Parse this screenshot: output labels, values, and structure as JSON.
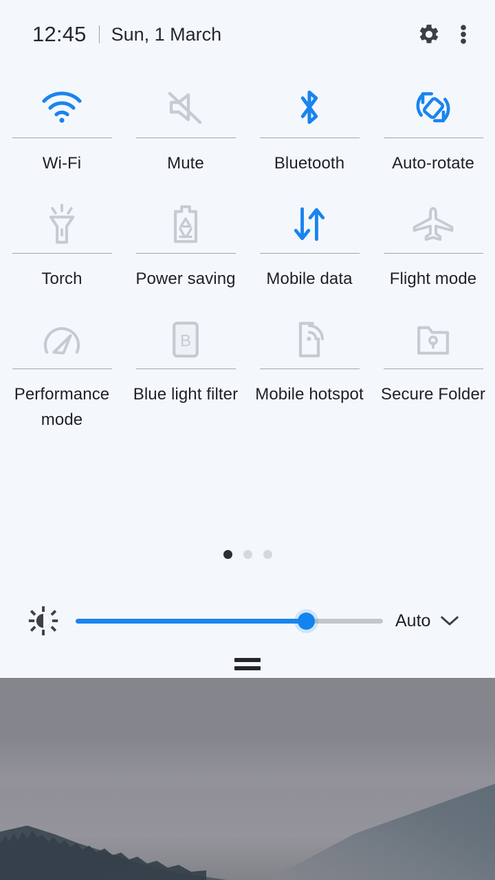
{
  "status": {
    "time": "12:45",
    "date": "Sun, 1 March",
    "settings_icon": "gear-icon",
    "overflow_icon": "three-dot-menu-icon"
  },
  "colors": {
    "panel_background": "#f4f8fc",
    "accent_active": "#1a84ef",
    "icon_inactive": "#c6cbd1",
    "text_primary": "#202124",
    "divider": "#6e757c",
    "handle": "#23272b"
  },
  "tiles": {
    "rows": [
      [
        {
          "label": "Wi-Fi",
          "icon": "wifi-icon",
          "state": "on"
        },
        {
          "label": "Mute",
          "icon": "volume-mute-icon",
          "state": "off"
        },
        {
          "label": "Bluetooth",
          "icon": "bluetooth-icon",
          "state": "on"
        },
        {
          "label": "Auto-rotate",
          "icon": "auto-rotate-icon",
          "state": "on"
        }
      ],
      [
        {
          "label": "Torch",
          "icon": "flashlight-icon",
          "state": "off"
        },
        {
          "label": "Power saving",
          "icon": "battery-saver-icon",
          "state": "off"
        },
        {
          "label": "Mobile data",
          "icon": "mobile-data-icon",
          "state": "on"
        },
        {
          "label": "Flight mode",
          "icon": "airplane-icon",
          "state": "off"
        }
      ],
      [
        {
          "label": "Performance mode",
          "icon": "speedometer-icon",
          "state": "off"
        },
        {
          "label": "Blue light filter",
          "icon": "blue-light-icon",
          "state": "off"
        },
        {
          "label": "Mobile hotspot",
          "icon": "mobile-hotspot-icon",
          "state": "off"
        },
        {
          "label": "Secure Folder",
          "icon": "secure-folder-icon",
          "state": "off"
        }
      ]
    ]
  },
  "pager": {
    "total_pages": 3,
    "active_page": 1
  },
  "brightness": {
    "icon": "brightness-icon",
    "value_percent": 75,
    "auto_label": "Auto",
    "chevron_icon": "chevron-down-icon"
  },
  "handle": {
    "icon": "drag-handle-icon"
  }
}
